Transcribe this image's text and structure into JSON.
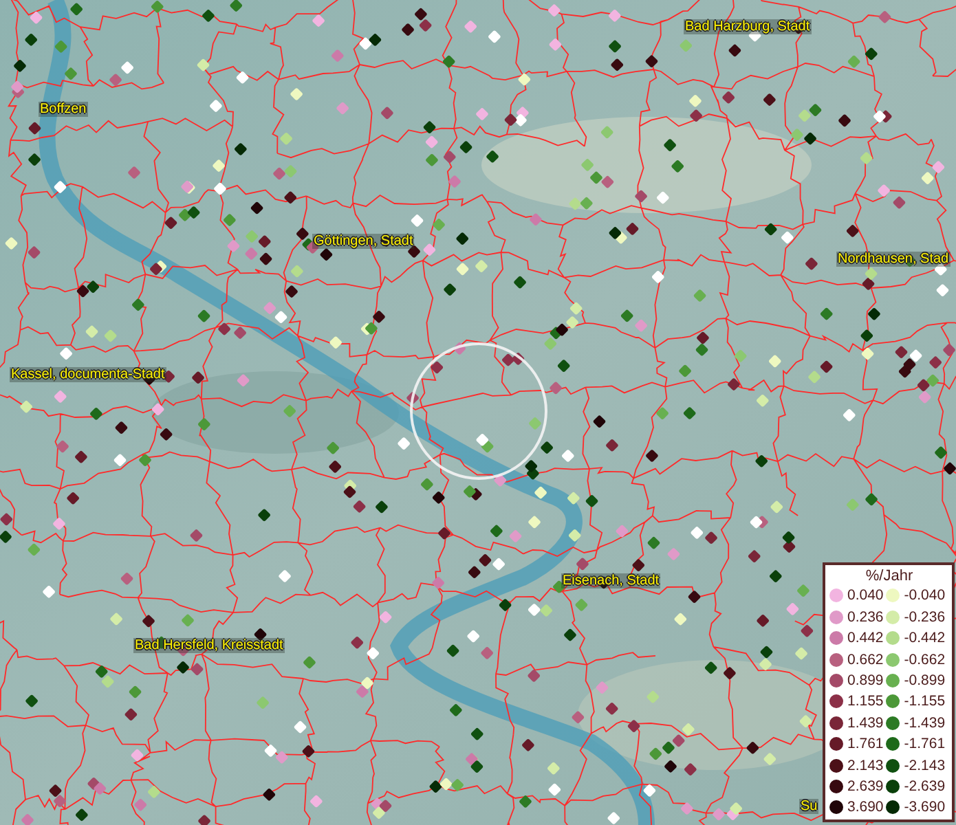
{
  "map": {
    "places": [
      {
        "name": "Bad Harzburg, Stadt"
      },
      {
        "name": "Boffzen"
      },
      {
        "name": "Göttingen, Stadt"
      },
      {
        "name": "Nordhausen, Stad"
      },
      {
        "name": "Kassel, documenta-Stadt"
      },
      {
        "name": "Eisenach, Stadt"
      },
      {
        "name": "Bad Hersfeld, Kreisstadt"
      },
      {
        "name": "Su"
      }
    ]
  },
  "legend": {
    "title": "%/Jahr",
    "positive": [
      {
        "label": "0.040",
        "color": "#f2b4e0"
      },
      {
        "label": "0.236",
        "color": "#e09ac8"
      },
      {
        "label": "0.442",
        "color": "#cc7aa8"
      },
      {
        "label": "0.662",
        "color": "#b8607f"
      },
      {
        "label": "0.899",
        "color": "#a44a68"
      },
      {
        "label": "1.155",
        "color": "#8c3048"
      },
      {
        "label": "1.439",
        "color": "#7a2638"
      },
      {
        "label": "1.761",
        "color": "#661a28"
      },
      {
        "label": "2.143",
        "color": "#4c1018"
      },
      {
        "label": "2.639",
        "color": "#380a10"
      },
      {
        "label": "3.690",
        "color": "#200508"
      }
    ],
    "negative": [
      {
        "label": "-0.040",
        "color": "#eef8c0"
      },
      {
        "label": "-0.236",
        "color": "#d4eca8"
      },
      {
        "label": "-0.442",
        "color": "#b4dc8c"
      },
      {
        "label": "-0.662",
        "color": "#8cc870"
      },
      {
        "label": "-0.899",
        "color": "#68b050"
      },
      {
        "label": "-1.155",
        "color": "#4c9838"
      },
      {
        "label": "-1.439",
        "color": "#2c7a24"
      },
      {
        "label": "-1.761",
        "color": "#1e6a1a"
      },
      {
        "label": "-2.143",
        "color": "#105010"
      },
      {
        "label": "-2.639",
        "color": "#0a400a"
      },
      {
        "label": "-3.690",
        "color": "#052a05"
      }
    ]
  }
}
